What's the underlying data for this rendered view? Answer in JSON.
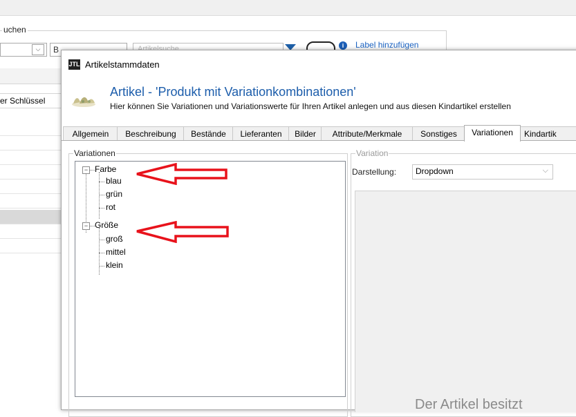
{
  "background": {
    "group_title": "uchen",
    "combo_glyph": "⌵",
    "input2_value": "B",
    "input3_placeholder": "Artikelsuche",
    "link_label": "Label hinzufügen",
    "info_glyph": "i",
    "column_header": "er Schlüssel",
    "filter_icon": "funnel-icon"
  },
  "dialog": {
    "title": "Artikelstammdaten",
    "app_icon_text": "JTL",
    "heading": "Artikel - 'Produkt mit Variationkombinationen'",
    "subheading": "Hier können Sie Variationen und Variationswerte für Ihren Artikel anlegen und aus diesen Kindartikel erstellen"
  },
  "tabs": [
    {
      "label": "Allgemein"
    },
    {
      "label": "Beschreibung"
    },
    {
      "label": "Bestände"
    },
    {
      "label": "Lieferanten"
    },
    {
      "label": "Bilder"
    },
    {
      "label": "Attribute/Merkmale"
    },
    {
      "label": "Sonstiges"
    },
    {
      "label": "Variationen",
      "active": true
    },
    {
      "label": "Kindartik"
    }
  ],
  "variationen": {
    "group_title": "Variationen",
    "expander_glyph": "−",
    "tree": [
      {
        "label": "Farbe",
        "children": [
          "blau",
          "grün",
          "rot"
        ]
      },
      {
        "label": "Größe",
        "children": [
          "groß",
          "mittel",
          "klein"
        ]
      }
    ]
  },
  "variation": {
    "group_title": "Variation",
    "darstellung_label": "Darstellung:",
    "darstellung_value": "Dropdown",
    "dropdown_glyph": "⌵",
    "preview_text": "Der Artikel besitzt"
  },
  "colors": {
    "accent": "#1c5dab",
    "annotation_arrow": "#e8121b"
  }
}
